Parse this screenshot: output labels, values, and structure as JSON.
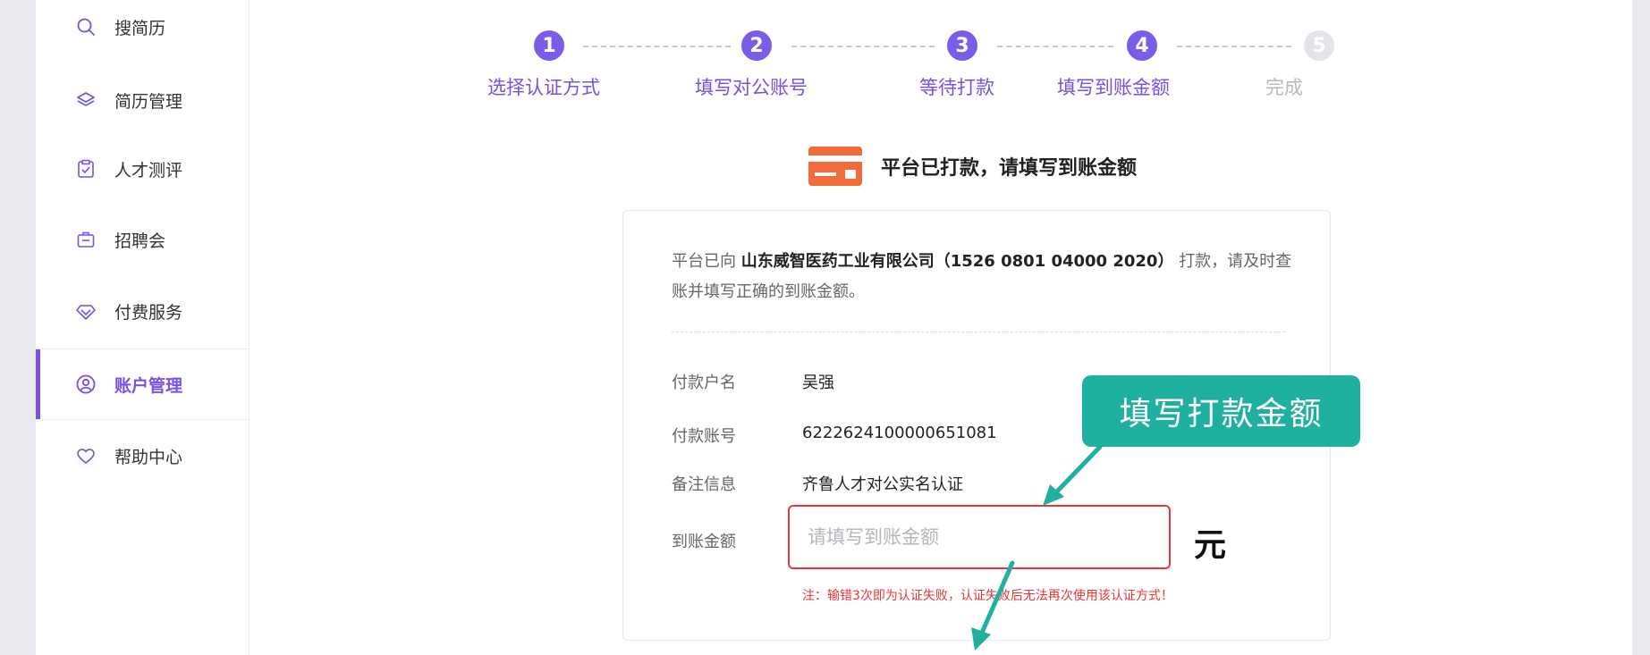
{
  "sidebar": {
    "items": [
      {
        "label": "搜简历",
        "icon": "search-icon"
      },
      {
        "label": "简历管理",
        "icon": "layers-icon"
      },
      {
        "label": "人才测评",
        "icon": "clipboard-check-icon"
      },
      {
        "label": "招聘会",
        "icon": "briefcase-icon"
      },
      {
        "label": "付费服务",
        "icon": "diamond-icon"
      },
      {
        "label": "账户管理",
        "icon": "user-circle-icon",
        "active": true
      },
      {
        "label": "帮助中心",
        "icon": "heart-icon"
      }
    ]
  },
  "steps": [
    {
      "num": "1",
      "label": "选择认证方式",
      "done": true
    },
    {
      "num": "2",
      "label": "填写对公账号",
      "done": true
    },
    {
      "num": "3",
      "label": "等待打款",
      "done": true
    },
    {
      "num": "4",
      "label": "填写到账金额",
      "done": true
    },
    {
      "num": "5",
      "label": "完成",
      "done": false
    }
  ],
  "heading": {
    "icon": "card-icon",
    "text": "平台已打款，请填写到账金额"
  },
  "card": {
    "intro_prefix": "平台已向",
    "company": "山东威智医药工业有限公司（1526 0801 04000 2020）",
    "intro_suffix": "打款，请及时查账并填写正确的到账金额。",
    "rows": [
      {
        "label": "付款户名",
        "value": "吴强"
      },
      {
        "label": "付款账号",
        "value": "6222624100000651081"
      },
      {
        "label": "备注信息",
        "value": "齐鲁人才对公实名认证"
      }
    ],
    "amount_label": "到账金额",
    "amount_placeholder": "请填写到账金额",
    "amount_value": "",
    "unit": "元",
    "note": "注：输错3次即为认证失败，认证失败后无法再次使用该认证方式！"
  },
  "callout": {
    "text": "填写打款金额"
  },
  "colors": {
    "accent": "#7b4fe3",
    "callout": "#1fb0a0",
    "error": "#e8363a"
  }
}
